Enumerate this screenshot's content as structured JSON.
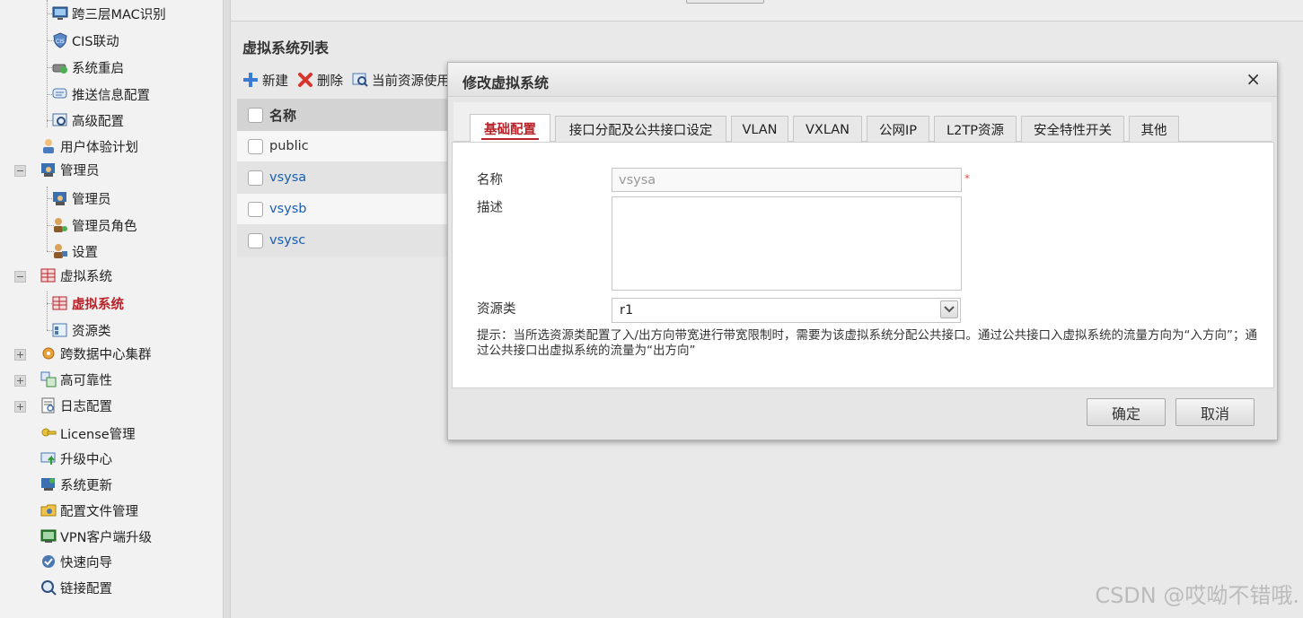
{
  "sidebar": {
    "items": [
      {
        "label": "跨三层MAC识别",
        "icon": "monitor-icon"
      },
      {
        "label": "CIS联动",
        "icon": "shield-icon"
      },
      {
        "label": "系统重启",
        "icon": "restart-icon"
      },
      {
        "label": "推送信息配置",
        "icon": "message-icon"
      },
      {
        "label": "高级配置",
        "icon": "advanced-icon"
      },
      {
        "label": "用户体验计划",
        "icon": "user-experience-icon"
      },
      {
        "label": "管理员",
        "icon": "admin-group-icon"
      },
      {
        "label": "管理员",
        "icon": "admin-icon"
      },
      {
        "label": "管理员角色",
        "icon": "admin-role-icon"
      },
      {
        "label": "设置",
        "icon": "settings-icon"
      },
      {
        "label": "虚拟系统",
        "icon": "virtual-system-group-icon"
      },
      {
        "label": "虚拟系统",
        "icon": "virtual-system-icon"
      },
      {
        "label": "资源类",
        "icon": "resource-class-icon"
      },
      {
        "label": "跨数据中心集群",
        "icon": "cluster-icon"
      },
      {
        "label": "高可靠性",
        "icon": "high-availability-icon"
      },
      {
        "label": "日志配置",
        "icon": "log-icon"
      },
      {
        "label": "License管理",
        "icon": "license-icon"
      },
      {
        "label": "升级中心",
        "icon": "upgrade-icon"
      },
      {
        "label": "系统更新",
        "icon": "system-update-icon"
      },
      {
        "label": "配置文件管理",
        "icon": "config-file-icon"
      },
      {
        "label": "VPN客户端升级",
        "icon": "vpn-icon"
      },
      {
        "label": "快速向导",
        "icon": "wizard-icon"
      },
      {
        "label": "链接配置",
        "icon": "link-config-icon"
      }
    ]
  },
  "panel": {
    "title": "虚拟系统列表",
    "toolbar": {
      "new_label": "新建",
      "delete_label": "删除",
      "usage_label": "当前资源使用"
    },
    "table": {
      "header": "名称",
      "rows": [
        "public",
        "vsysa",
        "vsysb",
        "vsysc"
      ]
    }
  },
  "dialog": {
    "title": "修改虚拟系统",
    "close": "×",
    "tabs": [
      "基础配置",
      "接口分配及公共接口设定",
      "VLAN",
      "VXLAN",
      "公网IP",
      "L2TP资源",
      "安全特性开关",
      "其他"
    ],
    "active_tab": "基础配置",
    "form": {
      "name_label": "名称",
      "name_value": "vsysa",
      "required_mark": "*",
      "desc_label": "描述",
      "desc_value": "",
      "resource_label": "资源类",
      "resource_value": "r1"
    },
    "hint": "提示：当所选资源类配置了入/出方向带宽进行带宽限制时，需要为该虚拟系统分配公共接口。通过公共接口入虚拟系统的流量方向为“入方向”；通过公共接口出虚拟系统的流量为“出方向”",
    "ok_label": "确定",
    "cancel_label": "取消"
  },
  "watermark": "CSDN @哎呦不错哦.",
  "colors": {
    "accent": "#b8232a",
    "link": "#1a5fb4"
  }
}
